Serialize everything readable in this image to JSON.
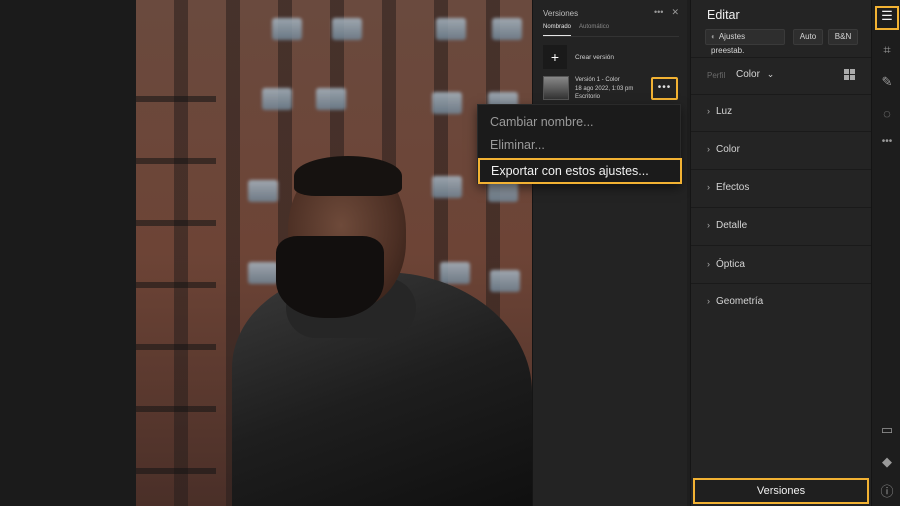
{
  "versions_panel": {
    "title": "Versiones",
    "tabs": [
      {
        "label": "Nombrado",
        "active": true
      },
      {
        "label": "Automático",
        "active": false
      }
    ],
    "create_label": "Crear versión",
    "version": {
      "name": "Versión 1 - Color",
      "date": "18 ago 2022, 1:03 pm",
      "device": "Escritorio"
    }
  },
  "context_menu": {
    "items": [
      "Cambiar nombre...",
      "Eliminar...",
      "Exportar con estos ajustes..."
    ],
    "highlighted": "Exportar con estos ajustes..."
  },
  "edit_panel": {
    "title": "Editar",
    "presets_label": "Ajustes preestab.",
    "auto_label": "Auto",
    "bw_label": "B&N",
    "profile_label": "Perfil",
    "profile_value": "Color",
    "sections": [
      "Luz",
      "Color",
      "Efectos",
      "Detalle",
      "Óptica",
      "Geometría"
    ],
    "versions_button": "Versiones"
  },
  "toolbar": {
    "icons": [
      "sliders-icon",
      "crop-icon",
      "healing-icon",
      "masking-icon",
      "more-icon",
      "comment-icon",
      "tag-icon",
      "info-icon"
    ],
    "active": "sliders-icon"
  },
  "colors": {
    "highlight": "#f2b233",
    "panel_bg": "#242424"
  }
}
